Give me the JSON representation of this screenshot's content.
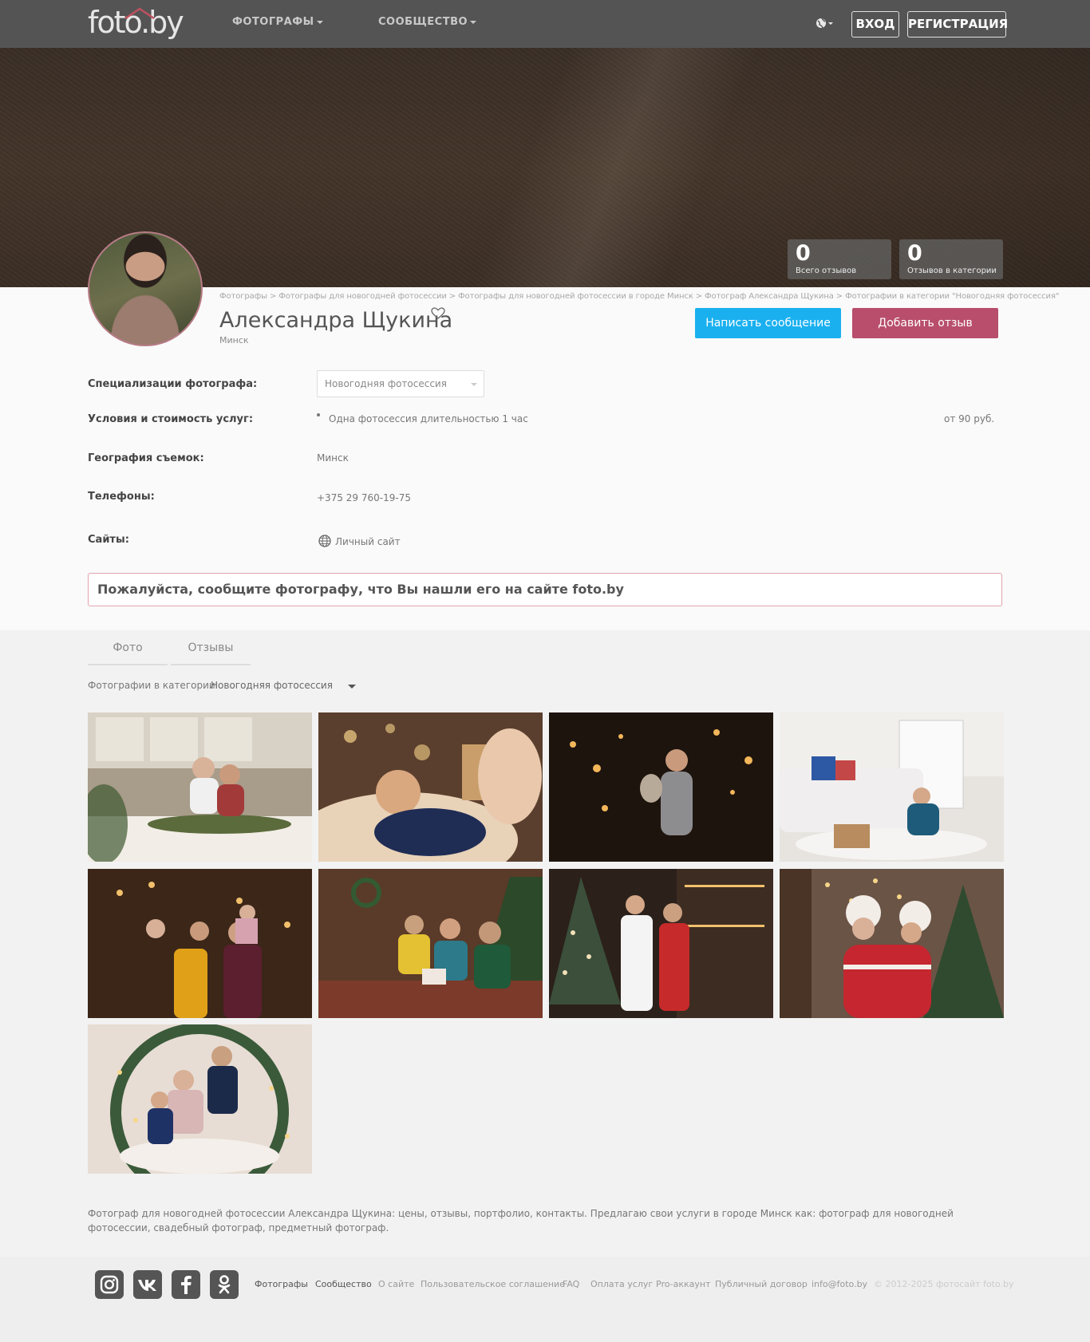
{
  "header": {
    "logo": "foto.by",
    "nav": [
      {
        "label": "ФОТОГРАФЫ"
      },
      {
        "label": "СООБЩЕСТВО"
      }
    ],
    "login_label": "ВХОД",
    "register_label": "РЕГИСТРАЦИЯ"
  },
  "stats": [
    {
      "value": "0",
      "label": "Всего отзывов"
    },
    {
      "value": "0",
      "label": "Отзывов в категории"
    }
  ],
  "breadcrumb": [
    "Фотографы",
    "Фотографы для новогодней фотосессии",
    "Фотографы для новогодней фотосессии в городе Минск",
    "Фотограф Александра Щукина",
    "Фотографии в категории \"Новогодняя фотосессия\""
  ],
  "breadcrumb_separator": ">",
  "profile": {
    "name": "Александра Щукина",
    "city": "Минск",
    "message_button": "Написать сообщение",
    "review_button": "Добавить отзыв"
  },
  "details": {
    "spec_label": "Специализации фотографа:",
    "spec_value": "Новогодняя фотосессия",
    "conditions_label": "Условия и стоимость услуг:",
    "service_name": "Одна фотосессия длительностью 1 час",
    "service_price": "от 90 руб.",
    "geo_label": "География съемок:",
    "geo_value": "Минск",
    "phones_label": "Телефоны:",
    "phone_value": "+375 29 760-19-75",
    "sites_label": "Сайты:",
    "site_value": "Личный сайт"
  },
  "notice": "Пожалуйста, сообщите фотографу, что Вы нашли его на сайте foto.by",
  "tabs": [
    {
      "label": "Фото"
    },
    {
      "label": "Отзывы"
    }
  ],
  "filter": {
    "label": "Фотографии в категории",
    "value": "Новогодняя фотосессия"
  },
  "seo_text": "Фотограф для новогодней фотосессии Александра Щукина: цены, отзывы, портфолио, контакты. Предлагаю свои услуги в городе Минск как: фотограф для новогодней фотосессии, свадебный фотограф, предметный фотограф.",
  "footer": {
    "social": [
      "instagram-icon",
      "vk-icon",
      "facebook-icon",
      "odnoklassniki-icon"
    ],
    "links": [
      {
        "label": "Фотографы"
      },
      {
        "label": "Сообщество"
      },
      {
        "label": "О сайте"
      },
      {
        "label": "Пользовательское соглашение"
      },
      {
        "label": "FAQ"
      },
      {
        "label": "Оплата услуг"
      },
      {
        "label": "Pro-аккаунт"
      },
      {
        "label": "Публичный договор"
      },
      {
        "label": "info@foto.by"
      }
    ],
    "copyright": "© 2012-2025 фотосайт foto.by"
  },
  "colors": {
    "header_bg": "#545454",
    "message_button": "#1ab0f0",
    "review_button": "#b84e6c",
    "notice_border": "#e4a3ad"
  }
}
